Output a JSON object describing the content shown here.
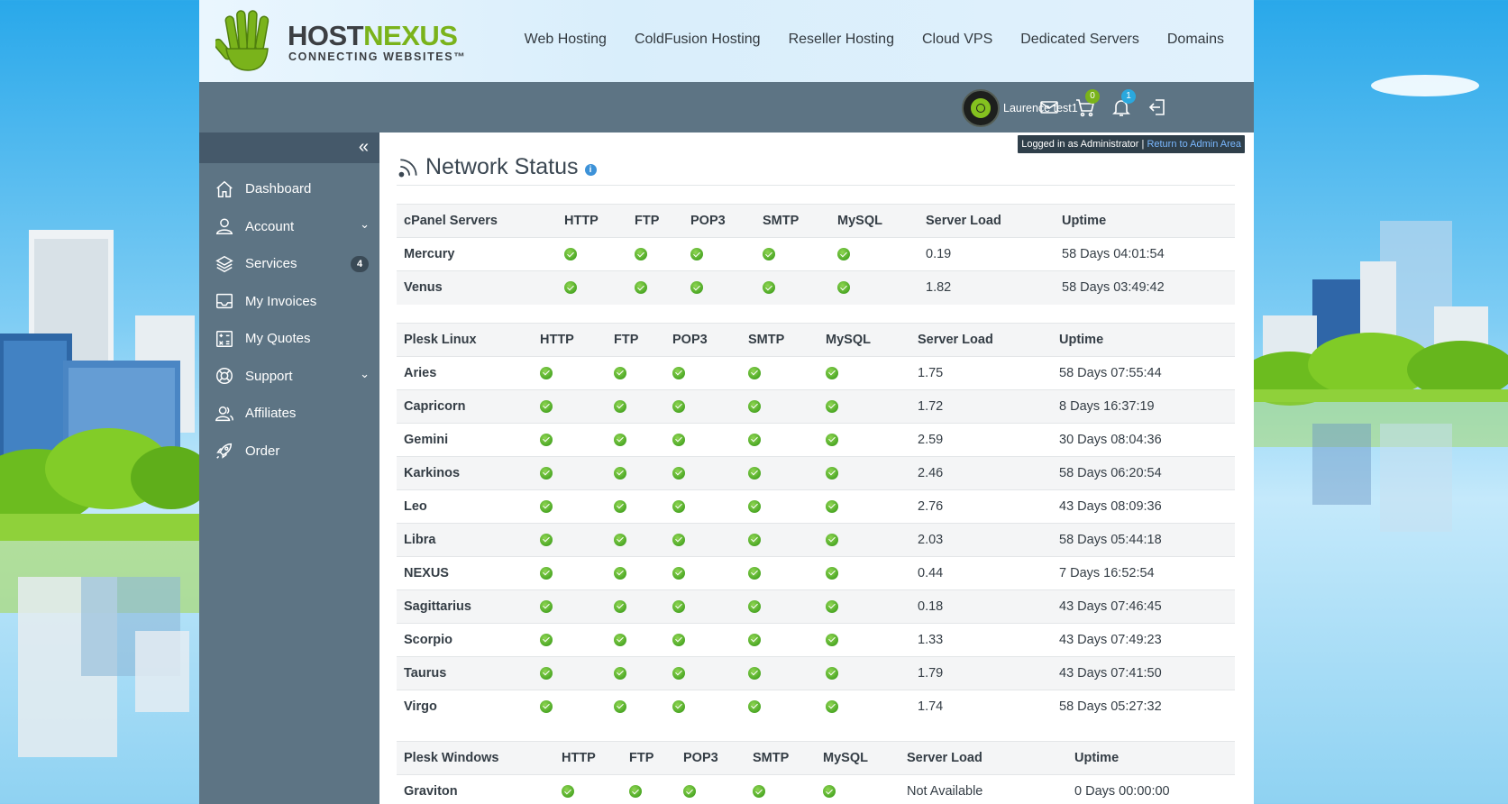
{
  "brand": {
    "name_part1": "HOST",
    "name_part2": "NEXUS",
    "tagline": "CONNECTING WEBSITES™"
  },
  "main_nav": [
    "Web Hosting",
    "ColdFusion Hosting",
    "Reseller Hosting",
    "Cloud VPS",
    "Dedicated Servers",
    "Domains"
  ],
  "topbar": {
    "username": "Laurence test1",
    "cart_count": "0",
    "notifications_count": "1",
    "admin_note_prefix": "Logged in as Administrator",
    "admin_note_separator": "|",
    "admin_note_link": "Return to Admin Area"
  },
  "sidebar": {
    "collapse_icon": "«",
    "items": [
      {
        "label": "Dashboard",
        "icon": "home-icon"
      },
      {
        "label": "Account",
        "icon": "user-icon",
        "chevron": "⌄"
      },
      {
        "label": "Services",
        "icon": "layers-icon",
        "badge": "4"
      },
      {
        "label": "My Invoices",
        "icon": "inbox-icon"
      },
      {
        "label": "My Quotes",
        "icon": "calculator-icon"
      },
      {
        "label": "Support",
        "icon": "lifebuoy-icon",
        "chevron": "⌄"
      },
      {
        "label": "Affiliates",
        "icon": "users-icon"
      },
      {
        "label": "Order",
        "icon": "rocket-icon"
      }
    ]
  },
  "page": {
    "title": "Network Status",
    "info_icon": "i"
  },
  "tables": [
    {
      "columns": [
        "cPanel Servers",
        "HTTP",
        "FTP",
        "POP3",
        "SMTP",
        "MySQL",
        "Server Load",
        "Uptime"
      ],
      "rows": [
        {
          "name": "Mercury",
          "load": "0.19",
          "uptime": "58 Days 04:01:54"
        },
        {
          "name": "Venus",
          "load": "1.82",
          "uptime": "58 Days 03:49:42"
        }
      ]
    },
    {
      "columns": [
        "Plesk Linux",
        "HTTP",
        "FTP",
        "POP3",
        "SMTP",
        "MySQL",
        "Server Load",
        "Uptime"
      ],
      "rows": [
        {
          "name": "Aries",
          "load": "1.75",
          "uptime": "58 Days 07:55:44"
        },
        {
          "name": "Capricorn",
          "load": "1.72",
          "uptime": "8 Days 16:37:19"
        },
        {
          "name": "Gemini",
          "load": "2.59",
          "uptime": "30 Days 08:04:36"
        },
        {
          "name": "Karkinos",
          "load": "2.46",
          "uptime": "58 Days 06:20:54"
        },
        {
          "name": "Leo",
          "load": "2.76",
          "uptime": "43 Days 08:09:36"
        },
        {
          "name": "Libra",
          "load": "2.03",
          "uptime": "58 Days 05:44:18"
        },
        {
          "name": "NEXUS",
          "load": "0.44",
          "uptime": "7 Days 16:52:54"
        },
        {
          "name": "Sagittarius",
          "load": "0.18",
          "uptime": "43 Days 07:46:45"
        },
        {
          "name": "Scorpio",
          "load": "1.33",
          "uptime": "43 Days 07:49:23"
        },
        {
          "name": "Taurus",
          "load": "1.79",
          "uptime": "43 Days 07:41:50"
        },
        {
          "name": "Virgo",
          "load": "1.74",
          "uptime": "58 Days 05:27:32"
        }
      ]
    },
    {
      "columns": [
        "Plesk Windows",
        "HTTP",
        "FTP",
        "POP3",
        "SMTP",
        "MySQL",
        "Server Load",
        "Uptime"
      ],
      "rows": [
        {
          "name": "Graviton",
          "load": "Not Available",
          "uptime": "0 Days 00:00:00"
        }
      ]
    }
  ],
  "colors": {
    "accent_green": "#7ab31b",
    "sidebar": "#5d7484",
    "link_blue": "#7ab8ff",
    "status_ok": "#4ca825"
  }
}
